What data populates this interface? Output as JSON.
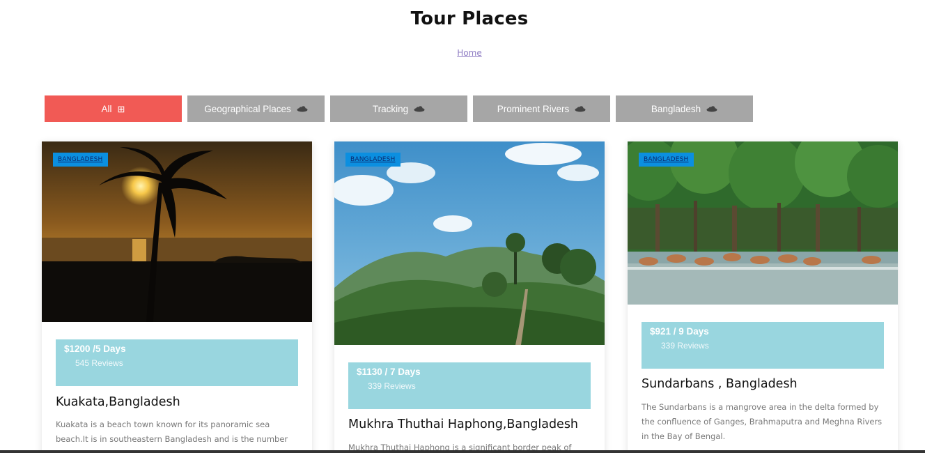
{
  "page": {
    "title": "Tour Places"
  },
  "breadcrumb": {
    "home": "Home"
  },
  "filters": [
    {
      "label": "All",
      "icon": "grid-icon",
      "active": true
    },
    {
      "label": "Geographical Places",
      "icon": "cloud-icon",
      "active": false
    },
    {
      "label": "Tracking",
      "icon": "cloud-icon",
      "active": false
    },
    {
      "label": "Prominent Rivers",
      "icon": "cloud-icon",
      "active": false
    },
    {
      "label": "Bangladesh",
      "icon": "cloud-icon",
      "active": false
    }
  ],
  "cards": [
    {
      "tag": "BANGLADESH",
      "price": "$1200 /5 Days",
      "reviews": "545 Reviews",
      "title": "Kuakata,Bangladesh",
      "description": "Kuakata is a beach town known for its panoramic sea beach.It is in southeastern Bangladesh and is the number"
    },
    {
      "tag": "BANGLADESH",
      "price": "$1130 / 7 Days",
      "reviews": "339 Reviews",
      "title": "Mukhra Thuthai Haphong,Bangladesh",
      "description": "Mukhra Thuthai Haphong is a significant border peak of"
    },
    {
      "tag": "BANGLADESH",
      "price": "$921 / 9 Days",
      "reviews": "339 Reviews",
      "title": "Sundarbans , Bangladesh",
      "description": "The Sundarbans is a mangrove area in the delta formed by the confluence of Ganges, Brahmaputra and Meghna Rivers in the Bay of Bengal."
    }
  ],
  "colors": {
    "active_filter": "#f15a55",
    "inactive_filter": "#a6a6a6",
    "price_box": "#99d6df",
    "tag": "#0b8fe0"
  }
}
